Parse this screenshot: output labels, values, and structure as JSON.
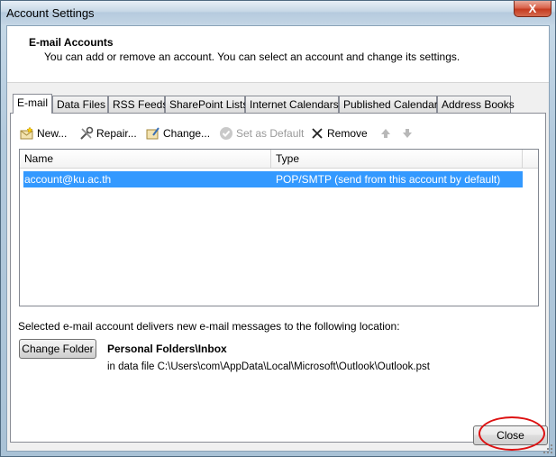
{
  "window": {
    "title": "Account Settings",
    "close_glyph": "X"
  },
  "header": {
    "title": "E-mail Accounts",
    "description": "You can add or remove an account. You can select an account and change its settings."
  },
  "tabs": [
    "E-mail",
    "Data Files",
    "RSS Feeds",
    "SharePoint Lists",
    "Internet Calendars",
    "Published Calendars",
    "Address Books"
  ],
  "active_tab": "E-mail",
  "toolbar": {
    "new_label": "New...",
    "repair_label": "Repair...",
    "change_label": "Change...",
    "set_default_label": "Set as Default",
    "remove_label": "Remove",
    "icons": [
      "new-account-icon",
      "repair-icon",
      "change-icon",
      "set-default-icon",
      "remove-icon",
      "move-up-icon",
      "move-down-icon"
    ]
  },
  "list": {
    "columns": [
      "Name",
      "Type"
    ],
    "rows": [
      {
        "name": "account@ku.ac.th",
        "type": "POP/SMTP (send from this account by default)",
        "selected": true
      }
    ]
  },
  "delivery": {
    "text": "Selected e-mail account delivers new e-mail messages to the following location:",
    "change_folder_label": "Change Folder",
    "folder_name": "Personal Folders\\Inbox",
    "data_file_path": "in data file C:\\Users\\com\\AppData\\Local\\Microsoft\\Outlook\\Outlook.pst"
  },
  "footer": {
    "close_label": "Close"
  },
  "colors": {
    "selection": "#3399ff",
    "annotation_circle": "#dd1111",
    "close_button_red": "#c53b20"
  }
}
